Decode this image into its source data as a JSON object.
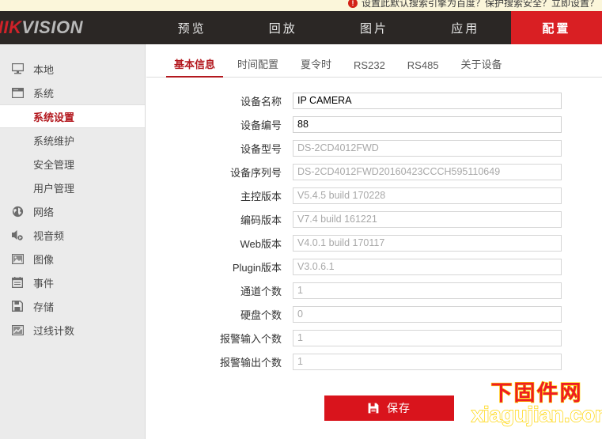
{
  "notice": {
    "badge": "!",
    "text": "设置此默认搜索引擎为百度？保护搜索安全？立即设置？"
  },
  "brand": {
    "logo_red": "HIK",
    "logo_gray": "VISION"
  },
  "topnav": {
    "items": [
      {
        "label": "预览",
        "active": false
      },
      {
        "label": "回放",
        "active": false
      },
      {
        "label": "图片",
        "active": false
      },
      {
        "label": "应用",
        "active": false
      },
      {
        "label": "配置",
        "active": true
      }
    ]
  },
  "sidebar": {
    "items": [
      {
        "label": "本地",
        "icon": "monitor-icon",
        "type": "top",
        "active": false
      },
      {
        "label": "系统",
        "icon": "system-icon",
        "type": "top",
        "active": false
      },
      {
        "label": "系统设置",
        "icon": "",
        "type": "sub",
        "active": true
      },
      {
        "label": "系统维护",
        "icon": "",
        "type": "sub",
        "active": false
      },
      {
        "label": "安全管理",
        "icon": "",
        "type": "sub",
        "active": false
      },
      {
        "label": "用户管理",
        "icon": "",
        "type": "sub",
        "active": false
      },
      {
        "label": "网络",
        "icon": "globe-icon",
        "type": "top",
        "active": false
      },
      {
        "label": "视音频",
        "icon": "audio-video-icon",
        "type": "top",
        "active": false
      },
      {
        "label": "图像",
        "icon": "image-icon",
        "type": "top",
        "active": false
      },
      {
        "label": "事件",
        "icon": "event-icon",
        "type": "top",
        "active": false
      },
      {
        "label": "存储",
        "icon": "storage-icon",
        "type": "top",
        "active": false
      },
      {
        "label": "过线计数",
        "icon": "line-count-icon",
        "type": "top",
        "active": false
      }
    ]
  },
  "tabs": [
    {
      "label": "基本信息",
      "active": true
    },
    {
      "label": "时间配置",
      "active": false
    },
    {
      "label": "夏令时",
      "active": false
    },
    {
      "label": "RS232",
      "active": false
    },
    {
      "label": "RS485",
      "active": false
    },
    {
      "label": "关于设备",
      "active": false
    }
  ],
  "form": {
    "fields": [
      {
        "label": "设备名称",
        "value": "IP CAMERA",
        "readonly": false
      },
      {
        "label": "设备编号",
        "value": "88",
        "readonly": false
      },
      {
        "label": "设备型号",
        "value": "DS-2CD4012FWD",
        "readonly": true
      },
      {
        "label": "设备序列号",
        "value": "DS-2CD4012FWD20160423CCCH595110649",
        "readonly": true
      },
      {
        "label": "主控版本",
        "value": "V5.4.5 build 170228",
        "readonly": true
      },
      {
        "label": "编码版本",
        "value": "V7.4 build 161221",
        "readonly": true
      },
      {
        "label": "Web版本",
        "value": "V4.0.1 build 170117",
        "readonly": true
      },
      {
        "label": "Plugin版本",
        "value": "V3.0.6.1",
        "readonly": true
      },
      {
        "label": "通道个数",
        "value": "1",
        "readonly": true
      },
      {
        "label": "硬盘个数",
        "value": "0",
        "readonly": true
      },
      {
        "label": "报警输入个数",
        "value": "1",
        "readonly": true
      },
      {
        "label": "报警输出个数",
        "value": "1",
        "readonly": true
      }
    ]
  },
  "actions": {
    "save_label": "保存"
  },
  "watermark": {
    "cn": "下固件网",
    "en": "xiagujian.com"
  },
  "colors": {
    "brand_red": "#d91f23",
    "nav_dark": "#2b2725",
    "sidebar_bg": "#ebebeb",
    "active_red": "#b3181e",
    "notice_bg": "#fbf6da",
    "watermark_red": "#ee1c25",
    "watermark_yellow": "#ffd400"
  }
}
